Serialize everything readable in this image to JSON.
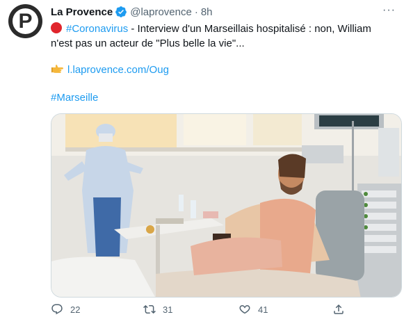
{
  "tweet": {
    "author_name": "La Provence",
    "handle": "@laprovence",
    "separator": "·",
    "time": "8h",
    "more": "···",
    "avatar_letter": "P",
    "hashtag_main": "#Coronavirus",
    "text_rest": " - Interview d'un Marseillais hospitalisé : non, William",
    "text_line2": "n'est pas un acteur de \"Plus belle la vie\"...",
    "link": "l.laprovence.com/Oug",
    "hashtag_footer": "#Marseille"
  },
  "actions": {
    "replies": "22",
    "retweets": "31",
    "likes": "41"
  },
  "colors": {
    "accent": "#1d9bf0",
    "text": "#0f1419",
    "muted": "#536471",
    "red_emoji": "#e0252c"
  },
  "icons": {
    "verified": "verified-badge-icon",
    "red_circle": "red-circle-emoji-icon",
    "pointing_hand": "backhand-index-pointing-right-icon",
    "reply": "reply-icon",
    "retweet": "retweet-icon",
    "like": "heart-icon",
    "share": "share-icon",
    "more": "more-icon"
  }
}
